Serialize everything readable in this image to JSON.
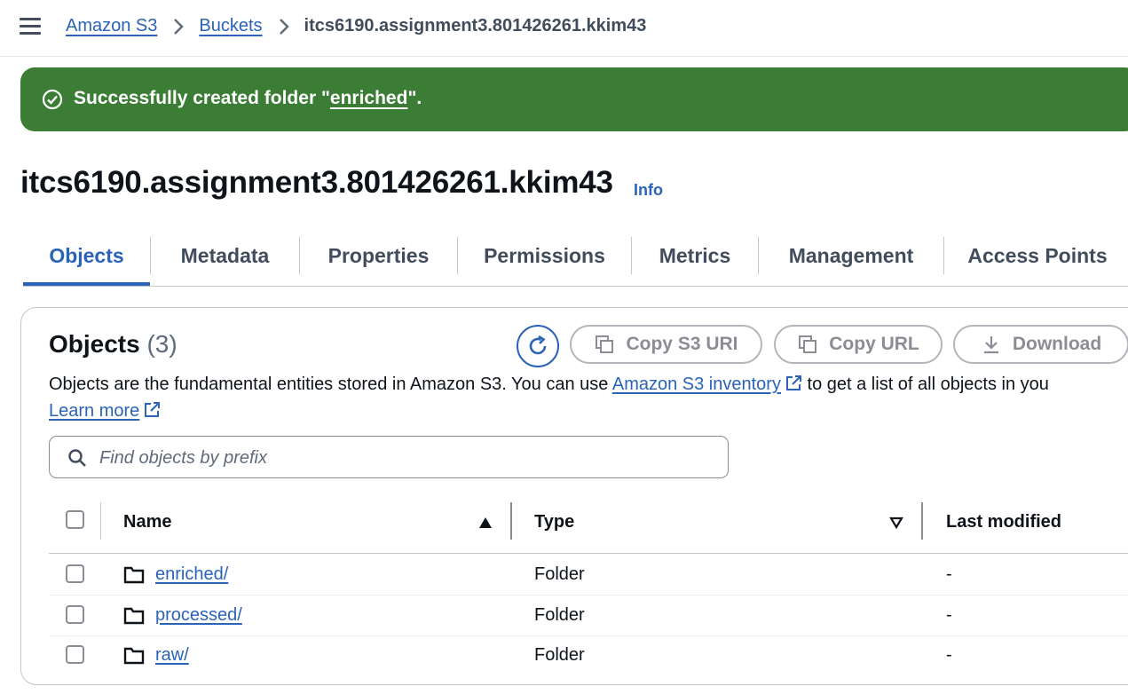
{
  "breadcrumb": {
    "items": [
      "Amazon S3",
      "Buckets"
    ],
    "current": "itcs6190.assignment3.801426261.kkim43"
  },
  "flash": {
    "prefix": "Successfully created folder \"",
    "folder": "enriched",
    "suffix": "\"."
  },
  "page": {
    "title": "itcs6190.assignment3.801426261.kkim43",
    "info_label": "Info"
  },
  "tabs": [
    "Objects",
    "Metadata",
    "Properties",
    "Permissions",
    "Metrics",
    "Management",
    "Access Points"
  ],
  "active_tab": "Objects",
  "objects": {
    "heading": "Objects",
    "count": "(3)",
    "actions": {
      "copy_uri": "Copy S3 URI",
      "copy_url": "Copy URL",
      "download": "Download"
    },
    "description_pre": "Objects are the fundamental entities stored in Amazon S3. You can use ",
    "inventory_link": "Amazon S3 inventory",
    "description_post": " to get a list of all objects in you",
    "learn_more": "Learn more",
    "search_placeholder": "Find objects by prefix",
    "columns": {
      "name": "Name",
      "type": "Type",
      "last_modified": "Last modified"
    },
    "rows": [
      {
        "name": "enriched/",
        "type": "Folder",
        "last_modified": "-"
      },
      {
        "name": "processed/",
        "type": "Folder",
        "last_modified": "-"
      },
      {
        "name": "raw/",
        "type": "Folder",
        "last_modified": "-"
      }
    ]
  },
  "colors": {
    "link": "#2a63b8",
    "success": "#3b7d35",
    "disabled": "#8c8c94"
  },
  "icons": [
    "menu-icon",
    "chevron-right-icon",
    "success-check-icon",
    "refresh-icon",
    "copy-icon",
    "download-icon",
    "external-link-icon",
    "search-icon",
    "sort-ascending-icon",
    "sort-descending-icon",
    "folder-icon"
  ]
}
